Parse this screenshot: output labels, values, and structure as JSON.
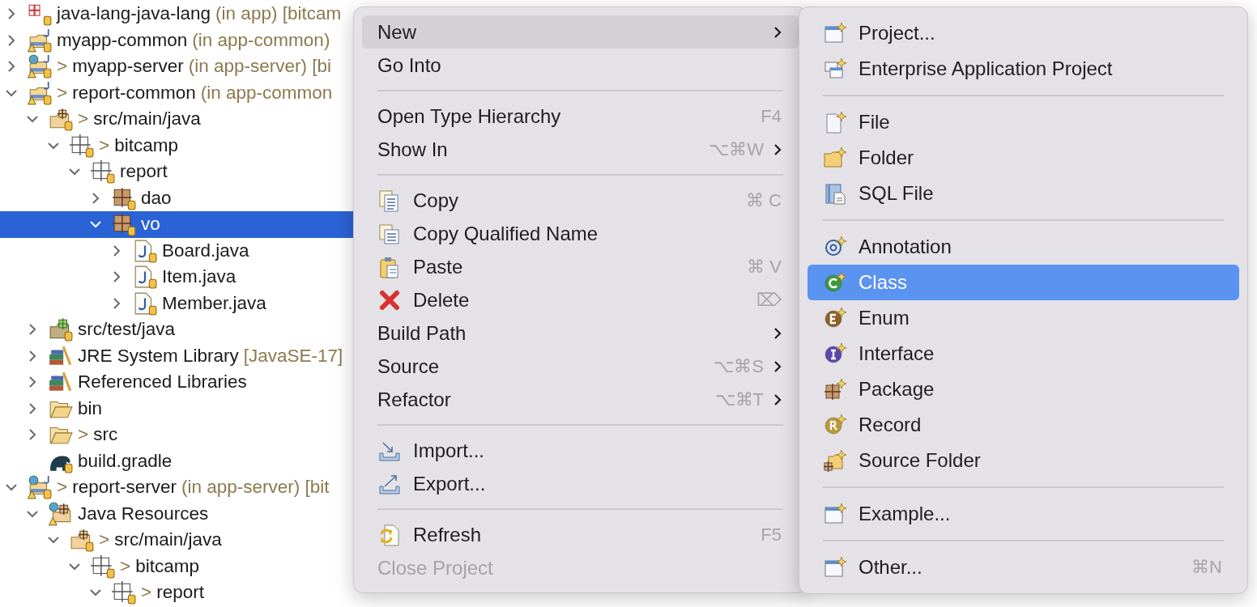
{
  "tree": [
    {
      "label": "java-lang-java-lang",
      "decoration": "(in app) [bitcam",
      "kind": "project-error",
      "expanded": false,
      "selected": false
    },
    {
      "label": "myapp-common",
      "decoration": "(in app-common)",
      "kind": "project",
      "expanded": false,
      "selected": false
    },
    {
      "prefix": ">",
      "label": "myapp-server",
      "decoration": "(in app-server) [bi",
      "kind": "web-project",
      "expanded": false,
      "selected": false
    },
    {
      "prefix": ">",
      "label": "report-common",
      "decoration": "(in app-common",
      "kind": "project",
      "expanded": true,
      "selected": false,
      "children": [
        {
          "prefix": ">",
          "label": "src/main/java",
          "kind": "source-folder",
          "expanded": true,
          "selected": false,
          "children": [
            {
              "prefix": ">",
              "label": "bitcamp",
              "kind": "empty-package",
              "expanded": true,
              "selected": false,
              "children": [
                {
                  "label": "report",
                  "kind": "empty-package",
                  "expanded": true,
                  "selected": false,
                  "children": [
                    {
                      "label": "dao",
                      "kind": "package",
                      "expanded": false,
                      "selected": false
                    },
                    {
                      "label": "vo",
                      "kind": "package",
                      "expanded": true,
                      "selected": true,
                      "children": [
                        {
                          "label": "Board.java",
                          "kind": "java-file",
                          "expanded": false,
                          "selected": false
                        },
                        {
                          "label": "Item.java",
                          "kind": "java-file",
                          "expanded": false,
                          "selected": false
                        },
                        {
                          "label": "Member.java",
                          "kind": "java-file",
                          "expanded": false,
                          "selected": false
                        }
                      ]
                    }
                  ]
                }
              ]
            }
          ]
        },
        {
          "label": "src/test/java",
          "kind": "test-folder",
          "expanded": false,
          "selected": false
        },
        {
          "label": "JRE System Library",
          "decoration": "[JavaSE-17]",
          "kind": "library",
          "expanded": false,
          "selected": false
        },
        {
          "label": "Referenced Libraries",
          "kind": "library",
          "expanded": false,
          "selected": false
        },
        {
          "label": "bin",
          "kind": "folder",
          "expanded": false,
          "selected": false
        },
        {
          "prefix": ">",
          "label": "src",
          "kind": "folder",
          "expanded": false,
          "selected": false
        },
        {
          "label": "build.gradle",
          "kind": "gradle-file",
          "selected": false
        }
      ]
    },
    {
      "prefix": ">",
      "label": "report-server",
      "decoration": "(in app-server) [bit",
      "kind": "web-project",
      "expanded": true,
      "selected": false,
      "children": [
        {
          "label": "Java Resources",
          "kind": "resources",
          "expanded": true,
          "selected": false,
          "children": [
            {
              "prefix": ">",
              "label": "src/main/java",
              "kind": "source-folder",
              "expanded": true,
              "selected": false,
              "children": [
                {
                  "prefix": ">",
                  "label": "bitcamp",
                  "kind": "empty-package",
                  "expanded": true,
                  "selected": false,
                  "children": [
                    {
                      "prefix": ">",
                      "label": "report",
                      "kind": "empty-package",
                      "expanded": true,
                      "selected": false
                    }
                  ]
                }
              ]
            }
          ]
        }
      ]
    }
  ],
  "context_menu": [
    {
      "kind": "item",
      "label": "New",
      "submenu": true,
      "selected": true,
      "disabled": false
    },
    {
      "kind": "item",
      "label": "Go Into",
      "selected": false,
      "disabled": false
    },
    {
      "kind": "separator"
    },
    {
      "kind": "item",
      "label": "Open Type Hierarchy",
      "shortcut": "F4",
      "selected": false,
      "disabled": false
    },
    {
      "kind": "item",
      "label": "Show In",
      "shortcut": "⌥⌘W",
      "submenu": true,
      "selected": false,
      "disabled": false
    },
    {
      "kind": "separator"
    },
    {
      "kind": "item",
      "label": "Copy",
      "shortcut": "⌘ C",
      "selected": false,
      "disabled": false
    },
    {
      "kind": "item",
      "label": "Copy Qualified Name",
      "selected": false,
      "disabled": false
    },
    {
      "kind": "item",
      "label": "Paste",
      "shortcut": "⌘ V",
      "selected": false,
      "disabled": false
    },
    {
      "kind": "item",
      "label": "Delete",
      "shortcut": "⌦",
      "selected": false,
      "disabled": false
    },
    {
      "kind": "item",
      "label": "Build Path",
      "submenu": true,
      "selected": false,
      "disabled": false
    },
    {
      "kind": "item",
      "label": "Source",
      "shortcut": "⌥⌘S",
      "submenu": true,
      "selected": false,
      "disabled": false
    },
    {
      "kind": "item",
      "label": "Refactor",
      "shortcut": "⌥⌘T",
      "submenu": true,
      "selected": false,
      "disabled": false
    },
    {
      "kind": "separator"
    },
    {
      "kind": "item",
      "label": "Import...",
      "selected": false,
      "disabled": false
    },
    {
      "kind": "item",
      "label": "Export...",
      "selected": false,
      "disabled": false
    },
    {
      "kind": "separator"
    },
    {
      "kind": "item",
      "label": "Refresh",
      "shortcut": "F5",
      "selected": false,
      "disabled": false
    },
    {
      "kind": "item",
      "label": "Close Project",
      "selected": false,
      "disabled": true
    }
  ],
  "new_submenu": [
    {
      "kind": "item",
      "label": "Project...",
      "selected": false
    },
    {
      "kind": "item",
      "label": "Enterprise Application Project",
      "selected": false
    },
    {
      "kind": "separator"
    },
    {
      "kind": "item",
      "label": "File",
      "selected": false
    },
    {
      "kind": "item",
      "label": "Folder",
      "selected": false
    },
    {
      "kind": "item",
      "label": "SQL File",
      "selected": false
    },
    {
      "kind": "separator"
    },
    {
      "kind": "item",
      "label": "Annotation",
      "selected": false
    },
    {
      "kind": "item",
      "label": "Class",
      "selected": true
    },
    {
      "kind": "item",
      "label": "Enum",
      "selected": false
    },
    {
      "kind": "item",
      "label": "Interface",
      "selected": false
    },
    {
      "kind": "item",
      "label": "Package",
      "selected": false
    },
    {
      "kind": "item",
      "label": "Record",
      "selected": false
    },
    {
      "kind": "item",
      "label": "Source Folder",
      "selected": false
    },
    {
      "kind": "separator"
    },
    {
      "kind": "item",
      "label": "Example...",
      "selected": false
    },
    {
      "kind": "separator"
    },
    {
      "kind": "item",
      "label": "Other...",
      "shortcut": "⌘N",
      "selected": false
    }
  ]
}
